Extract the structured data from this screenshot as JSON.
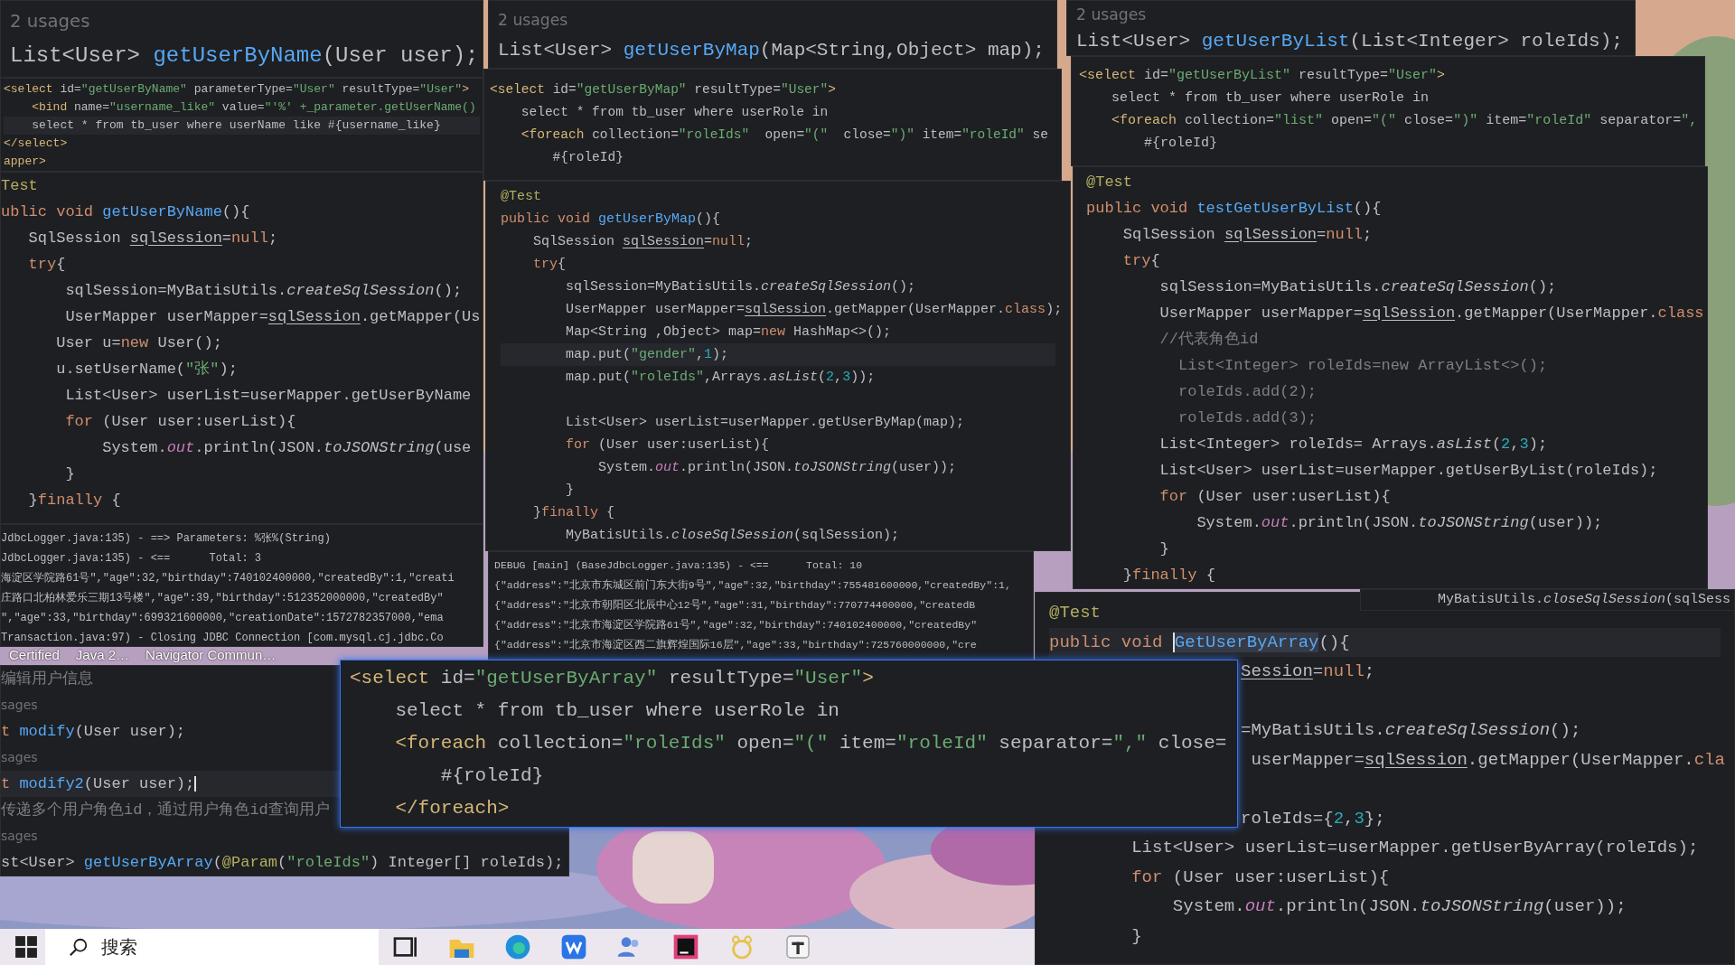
{
  "windows": [
    {
      "kind": "editor",
      "lines": [
        {
          "kind": "normal",
          "spans": [
            {
              "text": "2 usages",
              "kind": "hint"
            }
          ]
        },
        {
          "kind": "normal",
          "spans": [
            {
              "text": "List<User> ",
              "kind": "plain"
            },
            {
              "text": "getUserByName",
              "kind": "method"
            },
            {
              "text": "(User user);",
              "kind": "plain"
            }
          ]
        }
      ]
    },
    {
      "kind": "editor",
      "lines": [
        {
          "kind": "normal",
          "spans": [
            {
              "text": "<select ",
              "kind": "tag"
            },
            {
              "text": "id=",
              "kind": "plain"
            },
            {
              "text": "\"getUserByName\"",
              "kind": "string"
            },
            {
              "text": " parameterType=",
              "kind": "plain"
            },
            {
              "text": "\"User\"",
              "kind": "string"
            },
            {
              "text": " resultType=",
              "kind": "plain"
            },
            {
              "text": "\"User\"",
              "kind": "string"
            },
            {
              "text": ">",
              "kind": "tag"
            }
          ]
        },
        {
          "kind": "normal",
          "spans": [
            {
              "text": "    <bind ",
              "kind": "tag"
            },
            {
              "text": "name=",
              "kind": "plain"
            },
            {
              "text": "\"username_like\"",
              "kind": "string"
            },
            {
              "text": " value=",
              "kind": "plain"
            },
            {
              "text": "\"'%' +_parameter.getUserName()",
              "kind": "string"
            }
          ]
        },
        {
          "kind": "current",
          "spans": [
            {
              "text": "    select * from tb_user where userName like #{username_like}",
              "kind": "plain"
            }
          ]
        },
        {
          "kind": "normal",
          "spans": [
            {
              "text": "</select>",
              "kind": "tag"
            }
          ]
        },
        {
          "kind": "normal",
          "spans": [
            {
              "text": "apper>",
              "kind": "tag"
            }
          ]
        }
      ]
    },
    {
      "kind": "editor",
      "lines": [
        {
          "kind": "normal",
          "spans": [
            {
              "text": "Test",
              "kind": "annotation"
            }
          ]
        },
        {
          "kind": "normal",
          "spans": [
            {
              "text": "ublic void ",
              "kind": "keyword"
            },
            {
              "text": "getUserByName",
              "kind": "method"
            },
            {
              "text": "(){",
              "kind": "plain"
            }
          ]
        },
        {
          "kind": "normal",
          "spans": [
            {
              "text": "   SqlSession ",
              "kind": "plain"
            },
            {
              "text": "sqlSession",
              "kind": "var"
            },
            {
              "text": "=",
              "kind": "plain"
            },
            {
              "text": "null",
              "kind": "keyword"
            },
            {
              "text": ";",
              "kind": "plain"
            }
          ]
        },
        {
          "kind": "normal",
          "spans": [
            {
              "text": "   try",
              "kind": "keyword"
            },
            {
              "text": "{",
              "kind": "plain"
            }
          ]
        },
        {
          "kind": "normal",
          "spans": [
            {
              "text": "       sqlSession=MyBatisUtils.",
              "kind": "plain"
            },
            {
              "text": "createSqlSession",
              "kind": "static"
            },
            {
              "text": "();",
              "kind": "plain"
            }
          ]
        },
        {
          "kind": "normal",
          "spans": [
            {
              "text": "       UserMapper userMapper=",
              "kind": "plain"
            },
            {
              "text": "sqlSession",
              "kind": "var"
            },
            {
              "text": ".getMapper(Us",
              "kind": "plain"
            }
          ]
        },
        {
          "kind": "normal",
          "spans": [
            {
              "text": "      User u=",
              "kind": "plain"
            },
            {
              "text": "new",
              "kind": "keyword"
            },
            {
              "text": " User();",
              "kind": "plain"
            }
          ]
        },
        {
          "kind": "normal",
          "spans": [
            {
              "text": "      u.setUserName(",
              "kind": "plain"
            },
            {
              "text": "\"张\"",
              "kind": "string"
            },
            {
              "text": ");",
              "kind": "plain"
            }
          ]
        },
        {
          "kind": "normal",
          "spans": [
            {
              "text": "       List<User> userList=userMapper.getUserByName",
              "kind": "plain"
            }
          ]
        },
        {
          "kind": "normal",
          "spans": [
            {
              "text": "       for",
              "kind": "keyword"
            },
            {
              "text": " (User user:userList){",
              "kind": "plain"
            }
          ]
        },
        {
          "kind": "normal",
          "spans": [
            {
              "text": "           System.",
              "kind": "plain"
            },
            {
              "text": "out",
              "kind": "field"
            },
            {
              "text": ".println(JSON.",
              "kind": "plain"
            },
            {
              "text": "toJSONString",
              "kind": "static"
            },
            {
              "text": "(use",
              "kind": "plain"
            }
          ]
        },
        {
          "kind": "normal",
          "spans": [
            {
              "text": "       }",
              "kind": "plain"
            }
          ]
        },
        {
          "kind": "normal",
          "spans": [
            {
              "text": "   }",
              "kind": "plain"
            },
            {
              "text": "finally",
              "kind": "keyword"
            },
            {
              "text": " {",
              "kind": "plain"
            }
          ]
        }
      ]
    },
    {
      "kind": "console",
      "lines": [
        {
          "kind": "normal",
          "spans": [
            {
              "text": "JdbcLogger.java:135) - ==> Parameters: %张%(String)",
              "kind": "plain"
            }
          ]
        },
        {
          "kind": "normal",
          "spans": [
            {
              "text": "JdbcLogger.java:135) - <==      Total: 3",
              "kind": "plain"
            }
          ]
        },
        {
          "kind": "normal",
          "spans": [
            {
              "text": "海淀区学院路61号\",\"age\":32,\"birthday\":740102400000,\"createdBy\":1,\"creati",
              "kind": "plain"
            }
          ]
        },
        {
          "kind": "normal",
          "spans": [
            {
              "text": "庄路口北柏林爱乐三期13号楼\",\"age\":39,\"birthday\":512352000000,\"createdBy\"",
              "kind": "plain"
            }
          ]
        },
        {
          "kind": "normal",
          "spans": [
            {
              "text": "\",\"age\":33,\"birthday\":699321600000,\"creationDate\":1572782357000,\"ema",
              "kind": "plain"
            }
          ]
        },
        {
          "kind": "normal",
          "spans": [
            {
              "text": "Transaction.java:97) - Closing JDBC Connection [com.mysql.cj.jdbc.Co",
              "kind": "plain"
            }
          ]
        }
      ]
    },
    {
      "kind": "editor",
      "lines": [
        {
          "kind": "normal",
          "spans": [
            {
              "text": "编辑用户信息",
              "kind": "comment"
            }
          ]
        },
        {
          "kind": "normal",
          "spans": [
            {
              "text": "sages",
              "kind": "hint"
            }
          ]
        },
        {
          "kind": "normal",
          "spans": [
            {
              "text": "t ",
              "kind": "keyword"
            },
            {
              "text": "modify",
              "kind": "method"
            },
            {
              "text": "(User user);",
              "kind": "plain"
            }
          ]
        },
        {
          "kind": "normal",
          "spans": [
            {
              "text": "sages",
              "kind": "hint"
            }
          ]
        },
        {
          "kind": "current-caret",
          "spans": [
            {
              "text": "t ",
              "kind": "keyword"
            },
            {
              "text": "modify2",
              "kind": "method"
            },
            {
              "text": "(User user);",
              "kind": "plain"
            }
          ]
        },
        {
          "kind": "normal",
          "spans": [
            {
              "text": "传递多个用户角色id，通过用户角色id查询用户",
              "kind": "comment"
            }
          ]
        },
        {
          "kind": "normal",
          "spans": [
            {
              "text": "sages",
              "kind": "hint"
            }
          ]
        },
        {
          "kind": "normal",
          "spans": [
            {
              "text": "st<User> ",
              "kind": "plain"
            },
            {
              "text": "getUserByArray",
              "kind": "method"
            },
            {
              "text": "(",
              "kind": "plain"
            },
            {
              "text": "@Param",
              "kind": "annotation"
            },
            {
              "text": "(",
              "kind": "plain"
            },
            {
              "text": "\"roleIds\"",
              "kind": "string"
            },
            {
              "text": ") Integer[] roleIds);",
              "kind": "plain"
            }
          ]
        }
      ]
    },
    {
      "kind": "editor",
      "lines": [
        {
          "kind": "normal",
          "spans": [
            {
              "text": "2 usages",
              "kind": "hint"
            }
          ]
        },
        {
          "kind": "normal",
          "spans": [
            {
              "text": "List<User> ",
              "kind": "plain"
            },
            {
              "text": "getUserByMap",
              "kind": "method"
            },
            {
              "text": "(Map<String,Object> map);",
              "kind": "plain"
            }
          ]
        }
      ]
    },
    {
      "kind": "editor",
      "lines": [
        {
          "kind": "normal",
          "spans": [
            {
              "text": "<select ",
              "kind": "tag"
            },
            {
              "text": "id=",
              "kind": "plain"
            },
            {
              "text": "\"getUserByMap\"",
              "kind": "string"
            },
            {
              "text": " resultType=",
              "kind": "plain"
            },
            {
              "text": "\"User\"",
              "kind": "string"
            },
            {
              "text": ">",
              "kind": "tag"
            }
          ]
        },
        {
          "kind": "normal",
          "spans": [
            {
              "text": "    select * from tb_user where userRole in",
              "kind": "plain"
            }
          ]
        },
        {
          "kind": "normal",
          "spans": [
            {
              "text": "    <foreach ",
              "kind": "tag"
            },
            {
              "text": "collection=",
              "kind": "plain"
            },
            {
              "text": "\"roleIds\"",
              "kind": "string"
            },
            {
              "text": "  open=",
              "kind": "plain"
            },
            {
              "text": "\"(\"",
              "kind": "string"
            },
            {
              "text": "  close=",
              "kind": "plain"
            },
            {
              "text": "\")\"",
              "kind": "string"
            },
            {
              "text": " item=",
              "kind": "plain"
            },
            {
              "text": "\"roleId\"",
              "kind": "string"
            },
            {
              "text": " se",
              "kind": "plain"
            }
          ]
        },
        {
          "kind": "normal",
          "spans": [
            {
              "text": "        #{roleId}",
              "kind": "plain"
            }
          ]
        }
      ]
    },
    {
      "kind": "editor",
      "lines": [
        {
          "kind": "normal",
          "spans": [
            {
              "text": "@Test",
              "kind": "annotation"
            }
          ]
        },
        {
          "kind": "normal",
          "spans": [
            {
              "text": "public void ",
              "kind": "keyword"
            },
            {
              "text": "getUserByMap",
              "kind": "method"
            },
            {
              "text": "(){",
              "kind": "plain"
            }
          ]
        },
        {
          "kind": "normal",
          "spans": [
            {
              "text": "    SqlSession ",
              "kind": "plain"
            },
            {
              "text": "sqlSession",
              "kind": "var"
            },
            {
              "text": "=",
              "kind": "plain"
            },
            {
              "text": "null",
              "kind": "keyword"
            },
            {
              "text": ";",
              "kind": "plain"
            }
          ]
        },
        {
          "kind": "normal",
          "spans": [
            {
              "text": "    try",
              "kind": "keyword"
            },
            {
              "text": "{",
              "kind": "plain"
            }
          ]
        },
        {
          "kind": "normal",
          "spans": [
            {
              "text": "        sqlSession=MyBatisUtils.",
              "kind": "plain"
            },
            {
              "text": "createSqlSession",
              "kind": "static"
            },
            {
              "text": "();",
              "kind": "plain"
            }
          ]
        },
        {
          "kind": "normal",
          "spans": [
            {
              "text": "        UserMapper userMapper=",
              "kind": "plain"
            },
            {
              "text": "sqlSession",
              "kind": "var"
            },
            {
              "text": ".getMapper(UserMapper.",
              "kind": "plain"
            },
            {
              "text": "class",
              "kind": "keyword"
            },
            {
              "text": ");",
              "kind": "plain"
            }
          ]
        },
        {
          "kind": "normal",
          "spans": [
            {
              "text": "        Map<String ,Object> map=",
              "kind": "plain"
            },
            {
              "text": "new",
              "kind": "keyword"
            },
            {
              "text": " HashMap<>();",
              "kind": "plain"
            }
          ]
        },
        {
          "kind": "current",
          "spans": [
            {
              "text": "        map.put(",
              "kind": "plain"
            },
            {
              "text": "\"gender\"",
              "kind": "string"
            },
            {
              "text": ",",
              "kind": "plain"
            },
            {
              "text": "1",
              "kind": "number"
            },
            {
              "text": ");",
              "kind": "plain"
            }
          ]
        },
        {
          "kind": "normal",
          "spans": [
            {
              "text": "        map.put(",
              "kind": "plain"
            },
            {
              "text": "\"roleIds\"",
              "kind": "string"
            },
            {
              "text": ",Arrays.",
              "kind": "plain"
            },
            {
              "text": "asList",
              "kind": "static"
            },
            {
              "text": "(",
              "kind": "plain"
            },
            {
              "text": "2",
              "kind": "number"
            },
            {
              "text": ",",
              "kind": "plain"
            },
            {
              "text": "3",
              "kind": "number"
            },
            {
              "text": "));",
              "kind": "plain"
            }
          ]
        },
        {
          "kind": "gap"
        },
        {
          "kind": "normal",
          "spans": [
            {
              "text": "        List<User> userList=userMapper.getUserByMap(map);",
              "kind": "plain"
            }
          ]
        },
        {
          "kind": "normal",
          "spans": [
            {
              "text": "        for",
              "kind": "keyword"
            },
            {
              "text": " (User user:userList){",
              "kind": "plain"
            }
          ]
        },
        {
          "kind": "normal",
          "spans": [
            {
              "text": "            System.",
              "kind": "plain"
            },
            {
              "text": "out",
              "kind": "field"
            },
            {
              "text": ".println(JSON.",
              "kind": "plain"
            },
            {
              "text": "toJSONString",
              "kind": "static"
            },
            {
              "text": "(user));",
              "kind": "plain"
            }
          ]
        },
        {
          "kind": "normal",
          "spans": [
            {
              "text": "        }",
              "kind": "plain"
            }
          ]
        },
        {
          "kind": "normal",
          "spans": [
            {
              "text": "    }",
              "kind": "plain"
            },
            {
              "text": "finally",
              "kind": "keyword"
            },
            {
              "text": " {",
              "kind": "plain"
            }
          ]
        },
        {
          "kind": "normal",
          "spans": [
            {
              "text": "        MyBatisUtils.",
              "kind": "plain"
            },
            {
              "text": "closeSqlSession",
              "kind": "static"
            },
            {
              "text": "(sqlSession);",
              "kind": "plain"
            }
          ]
        }
      ]
    },
    {
      "kind": "console",
      "lines": [
        {
          "kind": "normal",
          "spans": [
            {
              "text": "DEBUG [main] (BaseJdbcLogger.java:135) - <==      Total: 10",
              "kind": "plain"
            }
          ]
        },
        {
          "kind": "normal",
          "spans": [
            {
              "text": "{\"address\":\"北京市东城区前门东大街9号\",\"age\":32,\"birthday\":755481600000,\"createdBy\":1,",
              "kind": "plain"
            }
          ]
        },
        {
          "kind": "normal",
          "spans": [
            {
              "text": "{\"address\":\"北京市朝阳区北辰中心12号\",\"age\":31,\"birthday\":770774400000,\"createdB",
              "kind": "plain"
            }
          ]
        },
        {
          "kind": "normal",
          "spans": [
            {
              "text": "{\"address\":\"北京市海淀区学院路61号\",\"age\":32,\"birthday\":740102400000,\"createdBy\"",
              "kind": "plain"
            }
          ]
        },
        {
          "kind": "normal",
          "spans": [
            {
              "text": "{\"address\":\"北京市海淀区西二旗辉煌国际16层\",\"age\":33,\"birthday\":725760000000,\"cre",
              "kind": "plain"
            }
          ]
        }
      ]
    },
    {
      "kind": "popup",
      "lines": [
        {
          "kind": "normal",
          "spans": [
            {
              "text": "<select ",
              "kind": "tag"
            },
            {
              "text": "id=",
              "kind": "plain"
            },
            {
              "text": "\"getUserByArray\"",
              "kind": "string"
            },
            {
              "text": " resultType=",
              "kind": "plain"
            },
            {
              "text": "\"User\"",
              "kind": "string"
            },
            {
              "text": ">",
              "kind": "tag"
            }
          ]
        },
        {
          "kind": "normal",
          "spans": [
            {
              "text": "    select * from tb_user where userRole in",
              "kind": "plain"
            }
          ]
        },
        {
          "kind": "normal",
          "spans": [
            {
              "text": "    <foreach ",
              "kind": "tag"
            },
            {
              "text": "collection=",
              "kind": "plain"
            },
            {
              "text": "\"roleIds\"",
              "kind": "string"
            },
            {
              "text": " open=",
              "kind": "plain"
            },
            {
              "text": "\"(\"",
              "kind": "string"
            },
            {
              "text": " item=",
              "kind": "plain"
            },
            {
              "text": "\"roleId\"",
              "kind": "string"
            },
            {
              "text": " separator=",
              "kind": "plain"
            },
            {
              "text": "\",\"",
              "kind": "string"
            },
            {
              "text": " close=",
              "kind": "plain"
            }
          ]
        },
        {
          "kind": "normal",
          "spans": [
            {
              "text": "        #{roleId}",
              "kind": "plain"
            }
          ]
        },
        {
          "kind": "normal",
          "spans": [
            {
              "text": "    </foreach>",
              "kind": "tag"
            }
          ]
        }
      ]
    },
    {
      "kind": "editor",
      "lines": [
        {
          "kind": "normal",
          "spans": [
            {
              "text": "2 usages",
              "kind": "hint"
            }
          ]
        },
        {
          "kind": "normal",
          "spans": [
            {
              "text": "List<User> ",
              "kind": "plain"
            },
            {
              "text": "getUserByList",
              "kind": "method"
            },
            {
              "text": "(List<Integer> roleIds);",
              "kind": "plain"
            }
          ]
        }
      ]
    },
    {
      "kind": "editor",
      "lines": [
        {
          "kind": "normal",
          "spans": [
            {
              "text": "<select ",
              "kind": "tag"
            },
            {
              "text": "id=",
              "kind": "plain"
            },
            {
              "text": "\"getUserByList\"",
              "kind": "string"
            },
            {
              "text": " resultType=",
              "kind": "plain"
            },
            {
              "text": "\"User\"",
              "kind": "string"
            },
            {
              "text": ">",
              "kind": "tag"
            }
          ]
        },
        {
          "kind": "normal",
          "spans": [
            {
              "text": "    select * from tb_user where userRole in",
              "kind": "plain"
            }
          ]
        },
        {
          "kind": "normal",
          "spans": [
            {
              "text": "    <foreach ",
              "kind": "tag"
            },
            {
              "text": "collection=",
              "kind": "plain"
            },
            {
              "text": "\"list\"",
              "kind": "string"
            },
            {
              "text": " open=",
              "kind": "plain"
            },
            {
              "text": "\"(\"",
              "kind": "string"
            },
            {
              "text": " close=",
              "kind": "plain"
            },
            {
              "text": "\")\"",
              "kind": "string"
            },
            {
              "text": " item=",
              "kind": "plain"
            },
            {
              "text": "\"roleId\"",
              "kind": "string"
            },
            {
              "text": " separator=",
              "kind": "plain"
            },
            {
              "text": "\",",
              "kind": "string"
            }
          ]
        },
        {
          "kind": "normal",
          "spans": [
            {
              "text": "        #{roleId}",
              "kind": "plain"
            }
          ]
        }
      ]
    },
    {
      "kind": "editor",
      "lines": [
        {
          "kind": "normal",
          "spans": [
            {
              "text": "@Test",
              "kind": "annotation"
            }
          ]
        },
        {
          "kind": "normal",
          "spans": [
            {
              "text": "public void ",
              "kind": "keyword"
            },
            {
              "text": "testGetUserByList",
              "kind": "method"
            },
            {
              "text": "(){",
              "kind": "plain"
            }
          ]
        },
        {
          "kind": "normal",
          "spans": [
            {
              "text": "    SqlSession ",
              "kind": "plain"
            },
            {
              "text": "sqlSession",
              "kind": "var"
            },
            {
              "text": "=",
              "kind": "plain"
            },
            {
              "text": "null",
              "kind": "keyword"
            },
            {
              "text": ";",
              "kind": "plain"
            }
          ]
        },
        {
          "kind": "normal",
          "spans": [
            {
              "text": "    try",
              "kind": "keyword"
            },
            {
              "text": "{",
              "kind": "plain"
            }
          ]
        },
        {
          "kind": "normal",
          "spans": [
            {
              "text": "        sqlSession=MyBatisUtils.",
              "kind": "plain"
            },
            {
              "text": "createSqlSession",
              "kind": "static"
            },
            {
              "text": "();",
              "kind": "plain"
            }
          ]
        },
        {
          "kind": "normal",
          "spans": [
            {
              "text": "        UserMapper userMapper=",
              "kind": "plain"
            },
            {
              "text": "sqlSession",
              "kind": "var"
            },
            {
              "text": ".getMapper(UserMapper.",
              "kind": "plain"
            },
            {
              "text": "class",
              "kind": "keyword"
            }
          ]
        },
        {
          "kind": "normal",
          "spans": [
            {
              "text": "        //代表角色id",
              "kind": "comment"
            }
          ]
        },
        {
          "kind": "normal",
          "spans": [
            {
              "text": "          List<Integer> roleIds=new ArrayList<>();",
              "kind": "dim"
            }
          ]
        },
        {
          "kind": "normal",
          "spans": [
            {
              "text": "          roleIds.add(2);",
              "kind": "dim"
            }
          ]
        },
        {
          "kind": "normal",
          "spans": [
            {
              "text": "          roleIds.add(3);",
              "kind": "dim"
            }
          ]
        },
        {
          "kind": "normal",
          "spans": [
            {
              "text": "        List<Integer> roleIds= Arrays.",
              "kind": "plain"
            },
            {
              "text": "asList",
              "kind": "static"
            },
            {
              "text": "(",
              "kind": "plain"
            },
            {
              "text": "2",
              "kind": "number"
            },
            {
              "text": ",",
              "kind": "plain"
            },
            {
              "text": "3",
              "kind": "number"
            },
            {
              "text": ");",
              "kind": "plain"
            }
          ]
        },
        {
          "kind": "normal",
          "spans": [
            {
              "text": "        List<User> userList=userMapper.getUserByList(roleIds);",
              "kind": "plain"
            }
          ]
        },
        {
          "kind": "normal",
          "spans": [
            {
              "text": "        for",
              "kind": "keyword"
            },
            {
              "text": " (User user:userList){",
              "kind": "plain"
            }
          ]
        },
        {
          "kind": "normal",
          "spans": [
            {
              "text": "            System.",
              "kind": "plain"
            },
            {
              "text": "out",
              "kind": "field"
            },
            {
              "text": ".println(JSON.",
              "kind": "plain"
            },
            {
              "text": "toJSONString",
              "kind": "static"
            },
            {
              "text": "(user));",
              "kind": "plain"
            }
          ]
        },
        {
          "kind": "normal",
          "spans": [
            {
              "text": "        }",
              "kind": "plain"
            }
          ]
        },
        {
          "kind": "normal",
          "spans": [
            {
              "text": "    }",
              "kind": "plain"
            },
            {
              "text": "finally",
              "kind": "keyword"
            },
            {
              "text": " {",
              "kind": "plain"
            }
          ]
        }
      ]
    },
    {
      "kind": "editor",
      "lines": [
        {
          "kind": "normal",
          "spans": [
            {
              "text": "MyBatisUtils.",
              "kind": "plain"
            },
            {
              "text": "closeSqlSession",
              "kind": "static"
            },
            {
              "text": "(sqlSess",
              "kind": "plain"
            }
          ]
        }
      ]
    },
    {
      "kind": "editor",
      "lines": [
        {
          "kind": "normal",
          "spans": [
            {
              "text": "@Test",
              "kind": "annotation"
            }
          ]
        },
        {
          "kind": "current",
          "spans": [
            {
              "text": "public void ",
              "kind": "keyword"
            },
            {
              "text": "GetUserByArray",
              "kind": "selected"
            },
            {
              "text": "(){",
              "kind": "plain"
            }
          ]
        },
        {
          "kind": "offset",
          "spans": [
            {
              "text": "Session",
              "kind": "var"
            },
            {
              "text": "=",
              "kind": "plain"
            },
            {
              "text": "null",
              "kind": "keyword"
            },
            {
              "text": ";",
              "kind": "plain"
            }
          ]
        },
        {
          "kind": "gap"
        },
        {
          "kind": "offset",
          "spans": [
            {
              "text": "=MyBatisUtils.",
              "kind": "plain"
            },
            {
              "text": "createSqlSession",
              "kind": "static"
            },
            {
              "text": "();",
              "kind": "plain"
            }
          ]
        },
        {
          "kind": "offset",
          "spans": [
            {
              "text": " userMapper=",
              "kind": "plain"
            },
            {
              "text": "sqlSession",
              "kind": "var"
            },
            {
              "text": ".getMapper(UserMapper.",
              "kind": "plain"
            },
            {
              "text": "cla",
              "kind": "keyword"
            }
          ]
        },
        {
          "kind": "gap"
        },
        {
          "kind": "offset",
          "spans": [
            {
              "text": "roleIds={",
              "kind": "plain"
            },
            {
              "text": "2",
              "kind": "number"
            },
            {
              "text": ",",
              "kind": "plain"
            },
            {
              "text": "3",
              "kind": "number"
            },
            {
              "text": "};",
              "kind": "plain"
            }
          ]
        },
        {
          "kind": "normal",
          "spans": [
            {
              "text": "        List<User> userList=userMapper.getUserByArray(roleIds);",
              "kind": "plain"
            }
          ]
        },
        {
          "kind": "normal",
          "spans": [
            {
              "text": "        for",
              "kind": "keyword"
            },
            {
              "text": " (User user:userList){",
              "kind": "plain"
            }
          ]
        },
        {
          "kind": "normal",
          "spans": [
            {
              "text": "            System.",
              "kind": "plain"
            },
            {
              "text": "out",
              "kind": "field"
            },
            {
              "text": ".println(JSON.",
              "kind": "plain"
            },
            {
              "text": "toJSONString",
              "kind": "static"
            },
            {
              "text": "(user));",
              "kind": "plain"
            }
          ]
        },
        {
          "kind": "normal",
          "spans": [
            {
              "text": "        }",
              "kind": "plain"
            }
          ]
        }
      ]
    }
  ],
  "desktop_icons": [
    {
      "label": "Certified"
    },
    {
      "label": "Java 2…"
    },
    {
      "label": "Navigator Commun…"
    }
  ],
  "taskbar": {
    "search": {
      "placeholder": "搜索"
    }
  }
}
